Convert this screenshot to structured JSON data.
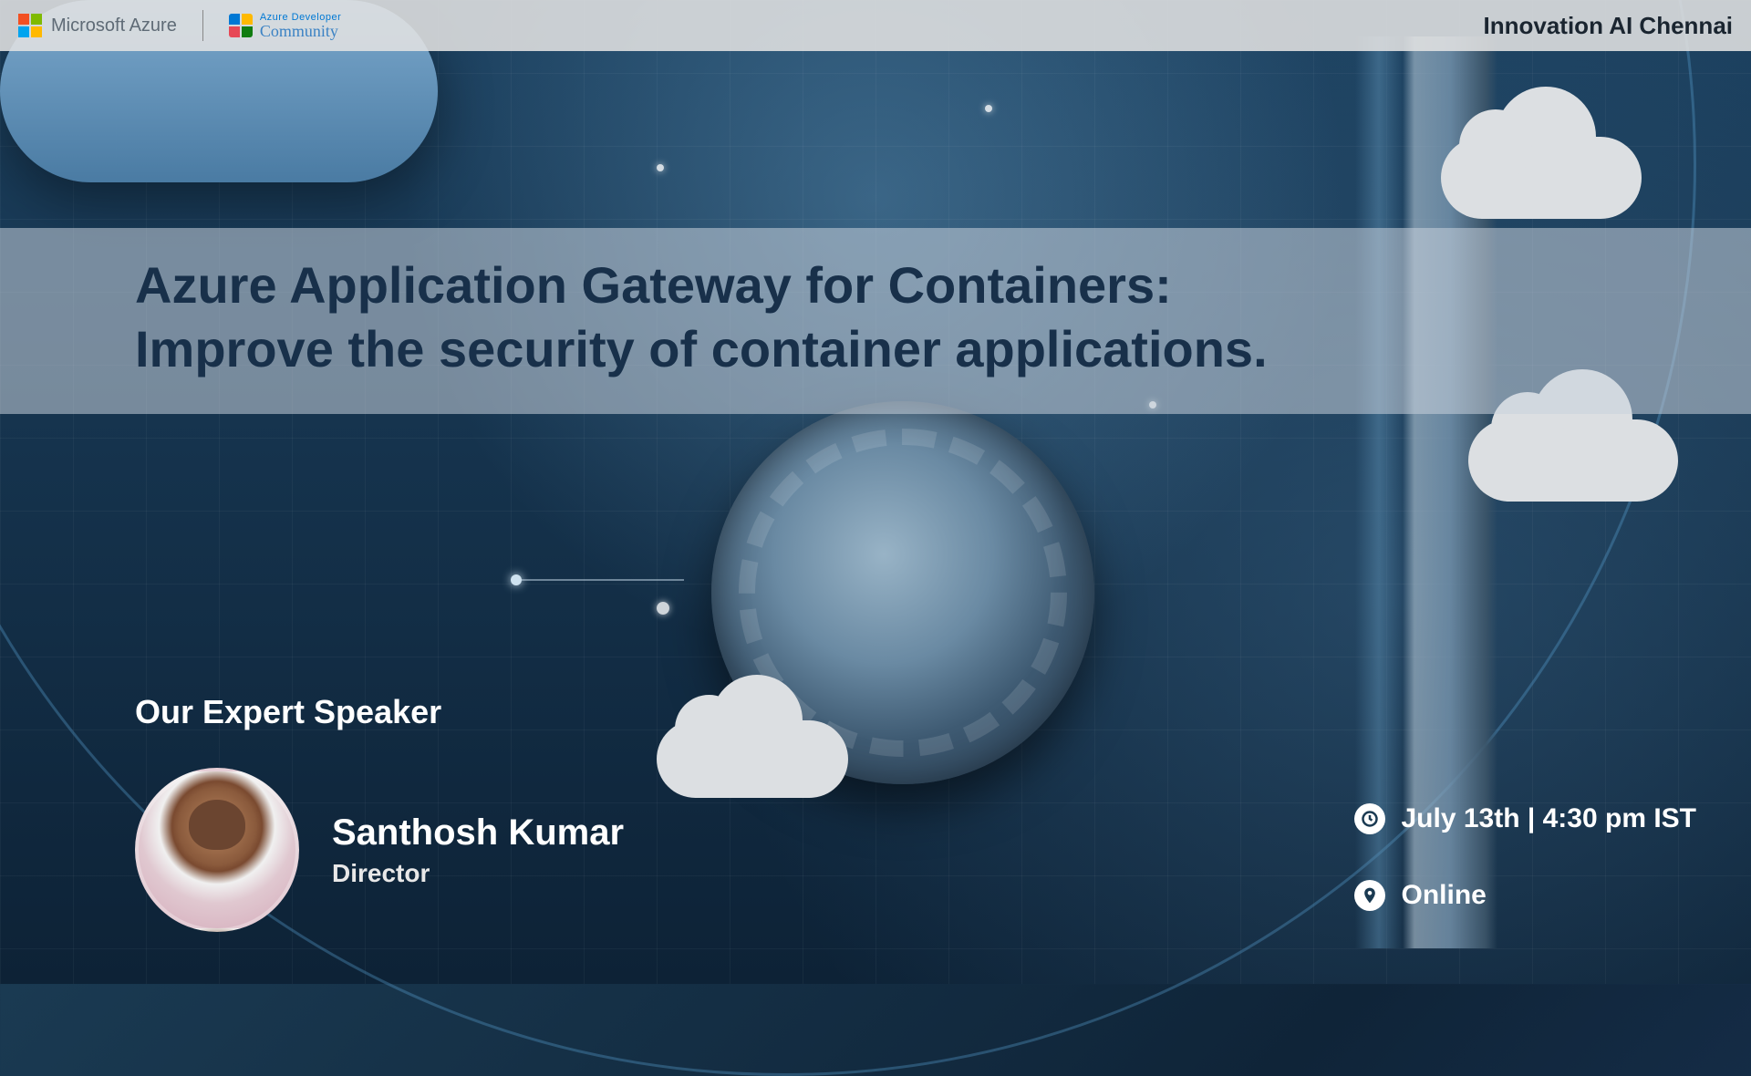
{
  "header": {
    "ms_label": "Microsoft Azure",
    "adc_top": "Azure Developer",
    "adc_script": "Community",
    "community_name": "Innovation AI Chennai"
  },
  "title": {
    "line1": "Azure Application Gateway for Containers:",
    "line2": "Improve the security of container applications."
  },
  "speaker": {
    "heading": "Our Expert Speaker",
    "name": "Santhosh Kumar",
    "role": "Director"
  },
  "event": {
    "datetime": "July 13th | 4:30 pm IST",
    "location": "Online"
  }
}
